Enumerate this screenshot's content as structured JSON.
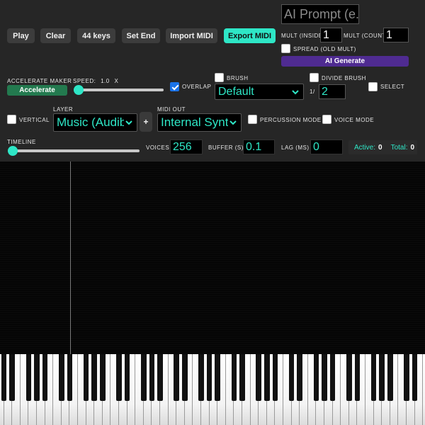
{
  "transport": {
    "play": "Play",
    "clear": "Clear",
    "keys": "44 keys",
    "set_end": "Set End",
    "import_midi": "Import MIDI",
    "export_midi": "Export MIDI"
  },
  "ai": {
    "prompt_placeholder": "AI Prompt (e.g",
    "mult_inside_label": "MULT (INSIDE)",
    "mult_inside_value": "1",
    "mult_count_label": "MULT (COUNT)",
    "mult_count_value": "1",
    "spread_label": "SPREAD (OLD MULT)",
    "spread_checked": false,
    "generate": "AI Generate"
  },
  "accelerate": {
    "maker_label": "ACCELERATE MAKER",
    "button": "Accelerate",
    "speed_label": "SPEED:",
    "speed_value": "1.0",
    "speed_unit": "X",
    "speed_fraction": 0.0
  },
  "overlap": {
    "label": "OVERLAP",
    "checked": true
  },
  "brush": {
    "label": "BRUSH",
    "checked": false,
    "selected": "Default",
    "divide_label": "DIVIDE BRUSH",
    "divide_checked": false,
    "divide_prefix": "1/",
    "divide_value": "2"
  },
  "select": {
    "label": "SELECT",
    "checked": false
  },
  "vertical": {
    "label": "VERTICAL",
    "checked": false
  },
  "layer": {
    "label": "LAYER",
    "selected": "Music (Audib",
    "add": "+"
  },
  "midi_out": {
    "label": "MIDI OUT",
    "selected": "Internal Synth"
  },
  "percussion": {
    "label": "PERCUSSION MODE",
    "checked": false
  },
  "voice_mode": {
    "label": "VOICE MODE",
    "checked": false
  },
  "timeline": {
    "label": "TIMELINE",
    "position_fraction": 0.0
  },
  "engine": {
    "voices_label": "VOICES",
    "voices_value": "256",
    "buffer_label": "BUFFER (S)",
    "buffer_value": "0.1",
    "lag_label": "LAG (MS)",
    "lag_value": "0"
  },
  "stats": {
    "active_label": "Active:",
    "active_value": "0",
    "total_label": "Total:",
    "total_value": "0"
  },
  "colors": {
    "accent": "#2ee6c6",
    "ai_generate": "#4f2b91",
    "accelerate": "#237a4f",
    "checkbox_on": "#1a73e8"
  }
}
